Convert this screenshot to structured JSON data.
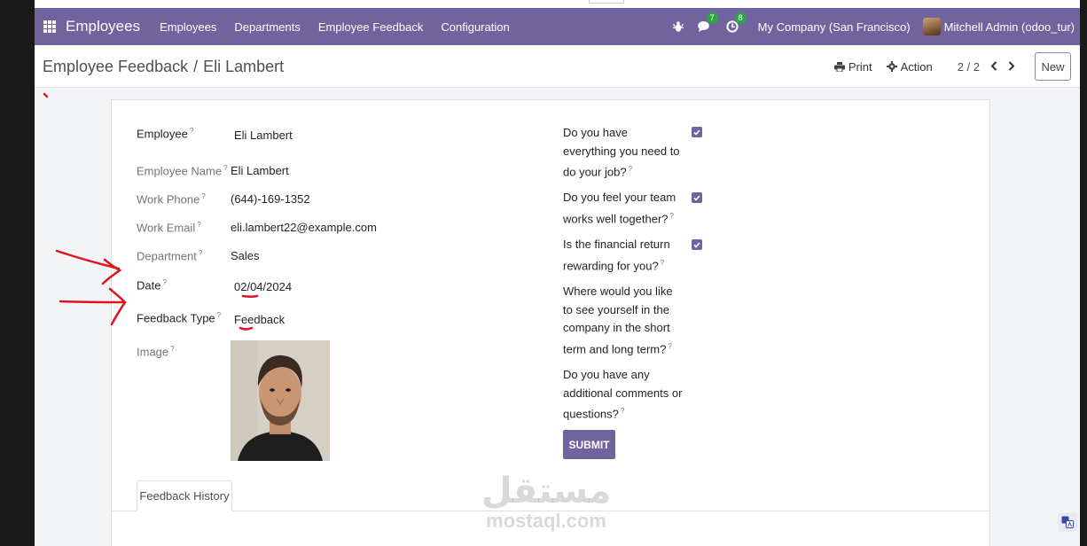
{
  "navbar": {
    "app_name": "Employees",
    "menu": [
      "Employees",
      "Departments",
      "Employee Feedback",
      "Configuration"
    ],
    "messages_count": "7",
    "activities_count": "8",
    "company": "My Company (San Francisco)",
    "user": "Mitchell Admin (odoo_tur)",
    "accent_color": "#71639e"
  },
  "control": {
    "breadcrumb_parent": "Employee Feedback",
    "breadcrumb_sep": "/",
    "breadcrumb_current": "Eli Lambert",
    "print_label": "Print",
    "action_label": "Action",
    "pager": "2 / 2",
    "new_label": "New"
  },
  "form": {
    "employee": {
      "label": "Employee",
      "value": "Eli Lambert"
    },
    "employee_name": {
      "label": "Employee Name",
      "value": "Eli Lambert"
    },
    "work_phone": {
      "label": "Work Phone",
      "value": "(644)-169-1352"
    },
    "work_email": {
      "label": "Work Email",
      "value": "eli.lambert22@example.com"
    },
    "department": {
      "label": "Department",
      "value": "Sales"
    },
    "date": {
      "label": "Date",
      "value": "02/04/2024"
    },
    "feedback_type": {
      "label": "Feedback Type",
      "value": "Feedback"
    },
    "image": {
      "label": "Image"
    },
    "help_mark": "?"
  },
  "questions": [
    {
      "text": "Do you have everything you need to do your job?",
      "checked": true
    },
    {
      "text": "Do you feel your team works well together?",
      "checked": true
    },
    {
      "text": "Is the financial return rewarding for you?",
      "checked": true
    },
    {
      "text": "Where would you like to see yourself in the company in the short term and long term?",
      "checked": false
    },
    {
      "text": "Do you have any additional comments or questions?",
      "checked": false
    }
  ],
  "submit_label": "SUBMIT",
  "tabs": [
    "Feedback History"
  ],
  "watermark": {
    "arabic": "مستقل",
    "latin": "mostaql.com"
  }
}
